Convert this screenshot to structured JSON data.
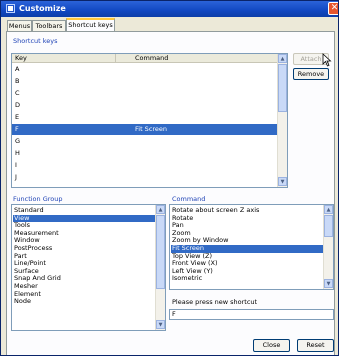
{
  "window": {
    "title": "Customize",
    "close_glyph": "✕"
  },
  "tabs": [
    {
      "label": "Menus",
      "active": false
    },
    {
      "label": "Toolbars",
      "active": false
    },
    {
      "label": "Shortcut keys",
      "active": true
    }
  ],
  "shortcut_keys": {
    "group_label": "Shortcut keys",
    "columns": [
      "Key",
      "Command"
    ],
    "rows": [
      {
        "key": "A",
        "command": ""
      },
      {
        "key": "B",
        "command": ""
      },
      {
        "key": "C",
        "command": ""
      },
      {
        "key": "D",
        "command": ""
      },
      {
        "key": "E",
        "command": ""
      },
      {
        "key": "F",
        "command": "Fit Screen",
        "selected": true
      },
      {
        "key": "G",
        "command": ""
      },
      {
        "key": "H",
        "command": ""
      },
      {
        "key": "I",
        "command": ""
      },
      {
        "key": "J",
        "command": ""
      }
    ]
  },
  "buttons": {
    "attach": "Attach",
    "remove": "Remove",
    "close": "Close",
    "reset": "Reset"
  },
  "function_group": {
    "label": "Function Group",
    "items": [
      "Standard",
      "View",
      "Tools",
      "Measurement",
      "Window",
      "PostProcess",
      "Part",
      "Line/Point",
      "Surface",
      "Snap And Grid",
      "Mesher",
      "Element",
      "Node"
    ],
    "selected_index": 1
  },
  "command_list": {
    "label": "Command",
    "items": [
      "Rotate about screen Z axis",
      "Rotate",
      "Pan",
      "Zoom",
      "Zoom by Window",
      "Fit Screen",
      "Top View (Z)",
      "Front View (X)",
      "Left View (Y)",
      "Isometric"
    ],
    "selected_index": 5
  },
  "new_shortcut": {
    "label": "Please press new shortcut",
    "value": "F"
  },
  "scroll_glyphs": {
    "up": "▲",
    "down": "▼"
  }
}
